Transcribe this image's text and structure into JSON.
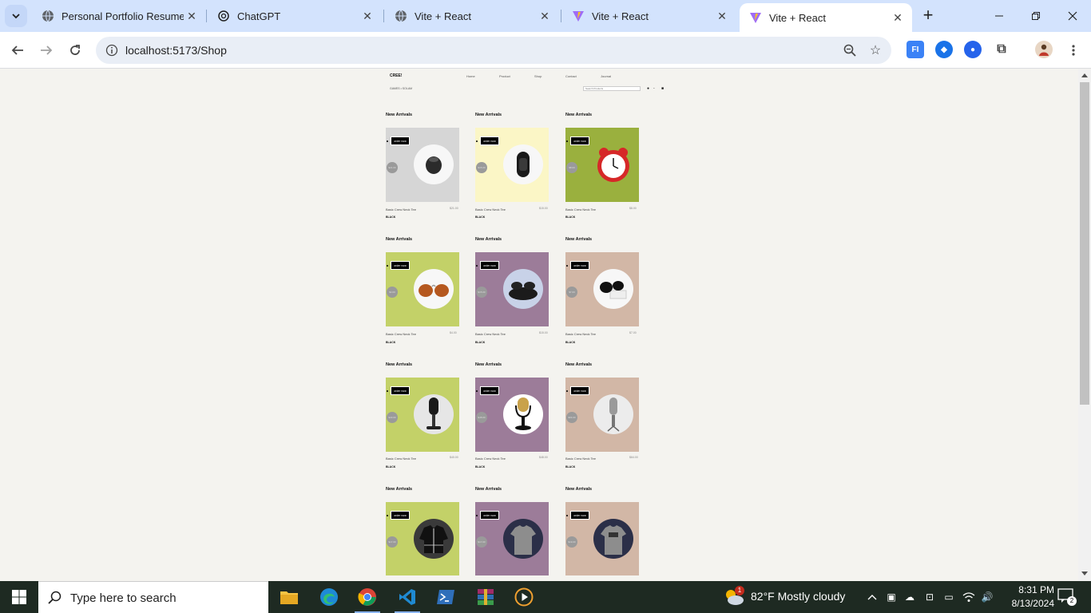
{
  "browser": {
    "tabs": [
      {
        "title": "Personal Portfolio Resume Re",
        "icon": "globe-icon"
      },
      {
        "title": "ChatGPT",
        "icon": "chatgpt-icon"
      },
      {
        "title": "Vite + React",
        "icon": "globe-icon"
      },
      {
        "title": "Vite + React",
        "icon": "vite-icon"
      },
      {
        "title": "Vite + React",
        "icon": "vite-icon",
        "active": true
      }
    ],
    "url": "localhost:5173/Shop"
  },
  "site": {
    "brand": "CREE!",
    "brand_sub": "GAMES • SOLAM",
    "nav": [
      "Home",
      "Product",
      "Shop",
      "Contact",
      "Journal"
    ],
    "search_placeholder": "Search Products",
    "sections": [
      {
        "label_1": "New Arrivals",
        "label_2": "New Arrivals",
        "label_3": "New Arrivals",
        "products": [
          {
            "order": "order now",
            "badge": "$21.00",
            "name": "Basic Crew Neck Tee",
            "price": "$21.00",
            "color": "BLACK",
            "bg": "#d6d6d6",
            "item": "airpod"
          },
          {
            "order": "order now",
            "badge": "$15.00",
            "name": "Basic Crew Neck Tee",
            "price": "$15.00",
            "color": "BLACK",
            "bg": "#fbf6c6",
            "item": "band"
          },
          {
            "order": "order now",
            "badge": "$8.00",
            "name": "Basic Crew Neck Tee",
            "price": "$8.00",
            "color": "BLACK",
            "bg": "#9ab03e",
            "item": "clock"
          }
        ]
      },
      {
        "label_1": "New Arrivals",
        "label_2": "New Arrivals",
        "label_3": "New Arrivals",
        "products": [
          {
            "order": "order now",
            "badge": "$4.00",
            "name": "Basic Crew Neck Tee",
            "price": "$4.00",
            "color": "BLACK",
            "bg": "#c3d168",
            "item": "sunglasses-brown"
          },
          {
            "order": "order now",
            "badge": "$15.00",
            "name": "Basic Crew Neck Tee",
            "price": "$15.00",
            "color": "BLACK",
            "bg": "#9c7c99",
            "item": "sunglasses-case"
          },
          {
            "order": "order now",
            "badge": "$7.00",
            "name": "Basic Crew Neck Tee",
            "price": "$7.00",
            "color": "BLACK",
            "bg": "#d2b7a6",
            "item": "sunglasses-black"
          }
        ]
      },
      {
        "label_1": "New Arrivals",
        "label_2": "New Arrivals",
        "label_3": "New Arrivals",
        "products": [
          {
            "order": "order now",
            "badge": "$40.00",
            "name": "Basic Crew Neck Tee",
            "price": "$40.00",
            "color": "BLACK",
            "bg": "#c3d168",
            "item": "mic-black"
          },
          {
            "order": "order now",
            "badge": "$48.00",
            "name": "Basic Crew Neck Tee",
            "price": "$48.00",
            "color": "BLACK",
            "bg": "#9c7c99",
            "item": "mic-gold"
          },
          {
            "order": "order now",
            "badge": "$64.00",
            "name": "Basic Crew Neck Tee",
            "price": "$64.00",
            "color": "BLACK",
            "bg": "#d2b7a6",
            "item": "mic-silver"
          }
        ]
      },
      {
        "label_1": "New Arrivals",
        "label_2": "New Arrivals",
        "label_3": "New Arrivals",
        "products": [
          {
            "order": "order now",
            "badge": "$17.00",
            "name": "",
            "price": "",
            "color": "",
            "bg": "#c3d168",
            "item": "jacket"
          },
          {
            "order": "order now",
            "badge": "$17.00",
            "name": "",
            "price": "",
            "color": "",
            "bg": "#9c7c99",
            "item": "tee-grey"
          },
          {
            "order": "order now",
            "badge": "$19.00",
            "name": "",
            "price": "",
            "color": "",
            "bg": "#d2b7a6",
            "item": "tee-print"
          }
        ]
      }
    ]
  },
  "taskbar": {
    "search_placeholder": "Type here to search",
    "weather": "82°F  Mostly cloudy",
    "weather_badge": "1",
    "time": "8:31 PM",
    "date": "8/13/2024",
    "notifications": "2"
  }
}
